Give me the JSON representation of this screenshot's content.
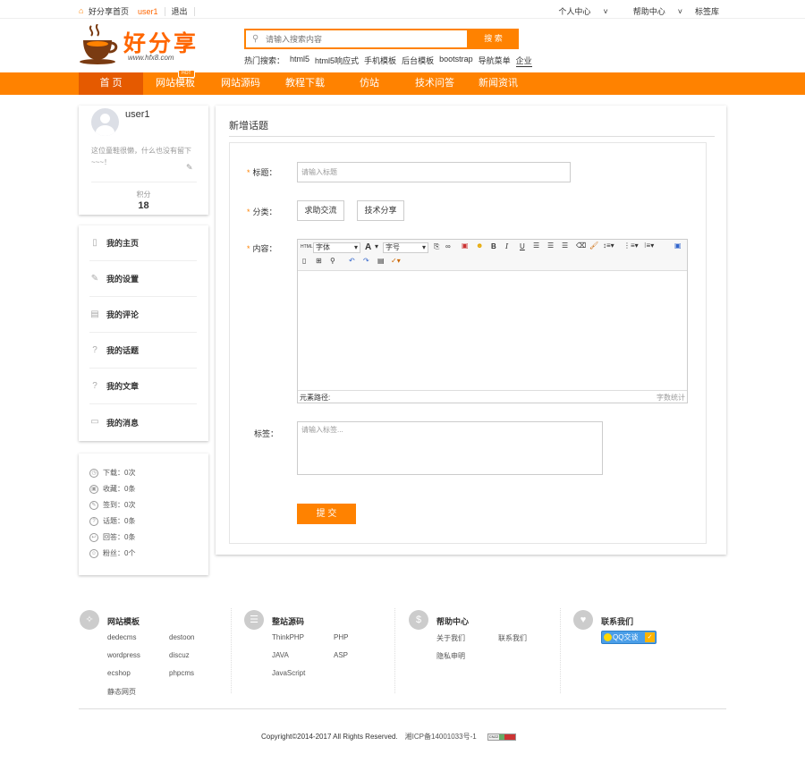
{
  "topbar": {
    "home": "好分享首页",
    "user": "user1",
    "logout": "退出",
    "personal_center": "个人中心",
    "help_center": "帮助中心",
    "address": "标签库"
  },
  "header": {
    "logo_text": "好分享",
    "logo_url": "www.hfx8.com",
    "search_placeholder": "请输入搜索内容",
    "search_button": "搜 索",
    "hot_label": "热门搜索：",
    "hot_items": [
      "html5",
      "html5响应式",
      "手机模板",
      "后台模板",
      "bootstrap",
      "导航菜单",
      "企业"
    ]
  },
  "nav": {
    "items": [
      "首 页",
      "网站模板",
      "网站源码",
      "教程下载",
      "仿站",
      "技术问答",
      "新闻资讯"
    ],
    "hot_badge": "HOT",
    "active_index": 0,
    "accent": "#ff8200"
  },
  "profile": {
    "username": "user1",
    "bio": "这位童鞋很懒，什么也没有留下~~~！",
    "score_label": "积分",
    "score": "18"
  },
  "menu": {
    "items": [
      {
        "label": "我的主页",
        "icon": "page-icon"
      },
      {
        "label": "我的设置",
        "icon": "pencil-icon"
      },
      {
        "label": "我的评论",
        "icon": "clipboard-icon"
      },
      {
        "label": "我的话题",
        "icon": "question-icon"
      },
      {
        "label": "我的文章",
        "icon": "question-icon"
      },
      {
        "label": "我的消息",
        "icon": "message-icon"
      }
    ]
  },
  "stats": {
    "items": [
      {
        "label": "下载：",
        "value": "0次"
      },
      {
        "label": "收藏：",
        "value": "0条"
      },
      {
        "label": "签到：",
        "value": "0次"
      },
      {
        "label": "话题：",
        "value": "0条"
      },
      {
        "label": "回答：",
        "value": "0条"
      },
      {
        "label": "粉丝：",
        "value": "0个"
      }
    ]
  },
  "form": {
    "heading": "新增话题",
    "title_label": "标题：",
    "title_placeholder": "请输入标题",
    "category_label": "分类：",
    "categories": [
      "求助交流",
      "技术分享"
    ],
    "content_label": "内容：",
    "editor": {
      "font_family": "字体",
      "font_size": "字号",
      "path_label": "元素路径:",
      "word_count": "字数统计"
    },
    "tags_label": "标签：",
    "tags_placeholder": "请输入标签...",
    "submit": "提 交"
  },
  "footer": {
    "cols": [
      {
        "title": "网站模板",
        "icon": "compass-icon",
        "links": [
          "dedecms",
          "destoon",
          "wordpress",
          "discuz",
          "ecshop",
          "phpcms",
          "静态网页"
        ]
      },
      {
        "title": "整站源码",
        "icon": "list-icon",
        "links": [
          "ThinkPHP",
          "PHP",
          "JAVA",
          "ASP",
          "JavaScript"
        ]
      },
      {
        "title": "帮助中心",
        "icon": "dollar-icon",
        "links": [
          "关于我们",
          "联系我们",
          "隐私申明"
        ]
      },
      {
        "title": "联系我们",
        "icon": "heart-icon",
        "links": []
      }
    ],
    "qq": "QQ交谈",
    "copyright": "Copyright©2014-2017 All Rights Reserved.",
    "icp": "湘ICP备14001033号-1",
    "cnzz": "CNZZ"
  }
}
